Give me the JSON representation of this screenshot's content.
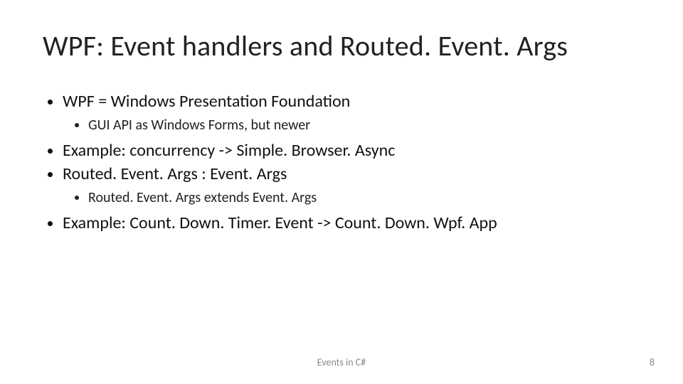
{
  "title": "WPF: Event handlers and Routed. Event. Args",
  "bullets": {
    "b1": "WPF = Windows Presentation Foundation",
    "b1_1": "GUI API as Windows Forms, but newer",
    "b2": "Example: concurrency -> Simple. Browser. Async",
    "b3": "Routed. Event. Args : Event. Args",
    "b3_1": "Routed. Event. Args extends Event. Args",
    "b4": "Example: Count. Down. Timer. Event -> Count. Down. Wpf. App"
  },
  "footer": "Events in C#",
  "page_number": "8"
}
